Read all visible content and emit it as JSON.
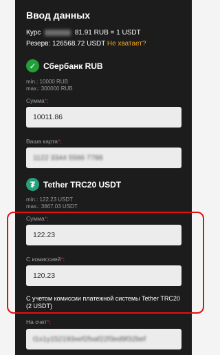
{
  "header": {
    "title": "Ввод данных"
  },
  "rate": {
    "label": "Курс",
    "value": "81.91 RUB = 1 USDT"
  },
  "reserve": {
    "label": "Резерв:",
    "value": "126568.72 USDT",
    "warning": "Не хватает?"
  },
  "sber": {
    "name": "Сбербанк RUB",
    "min": "min.: 10000 RUB",
    "max": "max.: 300000 RUB",
    "amount_label": "Сумма",
    "amount_value": "10011.86",
    "card_label": "Ваша карта",
    "card_value": "1122 3344 5566 7788"
  },
  "tether": {
    "name": "Tether TRC20 USDT",
    "min": "min.: 122.23 USDT",
    "max": "max.: 3667.03 USDT",
    "amount_label": "Сумма",
    "amount_value": "122.23",
    "commission_label": "С комиссией",
    "commission_value": "120.23",
    "note": "С учетом комиссии платежной системы Tether TRC20 (2 USDT)",
    "account_label": "На счет",
    "account_value": "t1x1y152193xef2fxaf22f3ed9f32bef"
  },
  "colors": {
    "panel": "#1c1c1c",
    "accent_warn": "#f5a524",
    "highlight": "#e01010",
    "sber": "#21a038",
    "tether": "#26a17b"
  }
}
